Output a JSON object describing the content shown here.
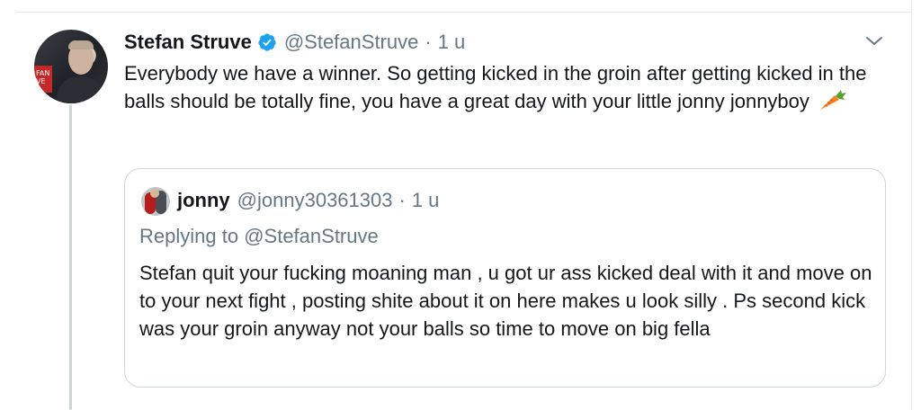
{
  "tweet": {
    "author_name": "Stefan Struve",
    "author_handle": "@StefanStruve",
    "separator": "·",
    "time": "1 u",
    "text": "Everybody we have a winner. So getting kicked in the groin after getting kicked in the balls should be totally fine, you have a great day with your little jonny jonnyboy",
    "emoji": "carrot-emoji",
    "verified_badge_color": "#1da1f2"
  },
  "quoted_tweet": {
    "author_name": "jonny",
    "author_handle": "@jonny30361303",
    "separator": "·",
    "time": "1 u",
    "replying_prefix": "Replying to",
    "replying_to": "@StefanStruve",
    "text": "Stefan quit your fucking moaning man , u got ur ass kicked deal with it and move on to your next fight , posting shite about it on here makes u look silly . Ps second kick was your groin anyway not your balls so time to move on big fella"
  },
  "colors": {
    "text_primary": "#14171a",
    "text_secondary": "#657786",
    "border": "#ccd6dd"
  },
  "avatar_banner_text": "FAN\nVE"
}
